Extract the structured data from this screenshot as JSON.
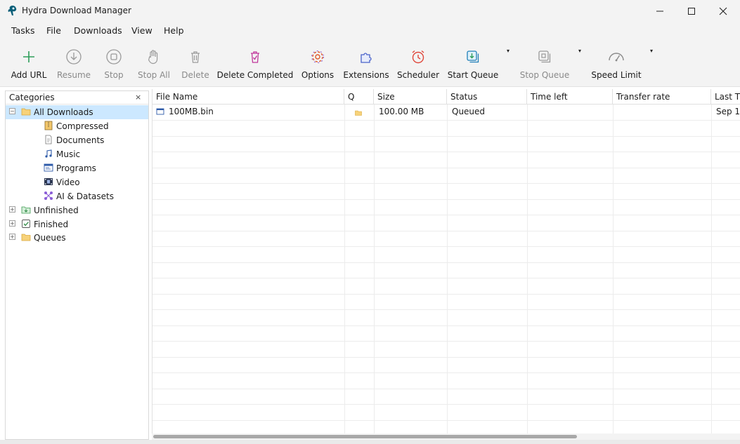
{
  "window": {
    "title": "Hydra Download Manager"
  },
  "menu": [
    "Tasks",
    "File",
    "Downloads",
    "View",
    "Help"
  ],
  "toolbar": {
    "add_url": "Add URL",
    "resume": "Resume",
    "stop": "Stop",
    "stop_all": "Stop All",
    "delete": "Delete",
    "delete_completed": "Delete Completed",
    "options": "Options",
    "extensions": "Extensions",
    "scheduler": "Scheduler",
    "start_queue": "Start Queue",
    "stop_queue": "Stop Queue",
    "speed_limit": "Speed Limit",
    "dropdown_arrow": "▾"
  },
  "sidebar": {
    "title": "Categories",
    "close": "×",
    "all_downloads": "All Downloads",
    "categories": [
      "Compressed",
      "Documents",
      "Music",
      "Programs",
      "Video",
      "AI & Datasets"
    ],
    "unfinished": "Unfinished",
    "finished": "Finished",
    "queues": "Queues"
  },
  "columns": [
    "File Name",
    "Q",
    "Size",
    "Status",
    "Time left",
    "Transfer rate",
    "Last T"
  ],
  "rows": [
    {
      "file": "100MB.bin",
      "size": "100.00 MB",
      "status": "Queued",
      "last": "Sep 1"
    }
  ],
  "colors": {
    "selection": "#cce8ff",
    "accent": "#2e9e5a"
  }
}
